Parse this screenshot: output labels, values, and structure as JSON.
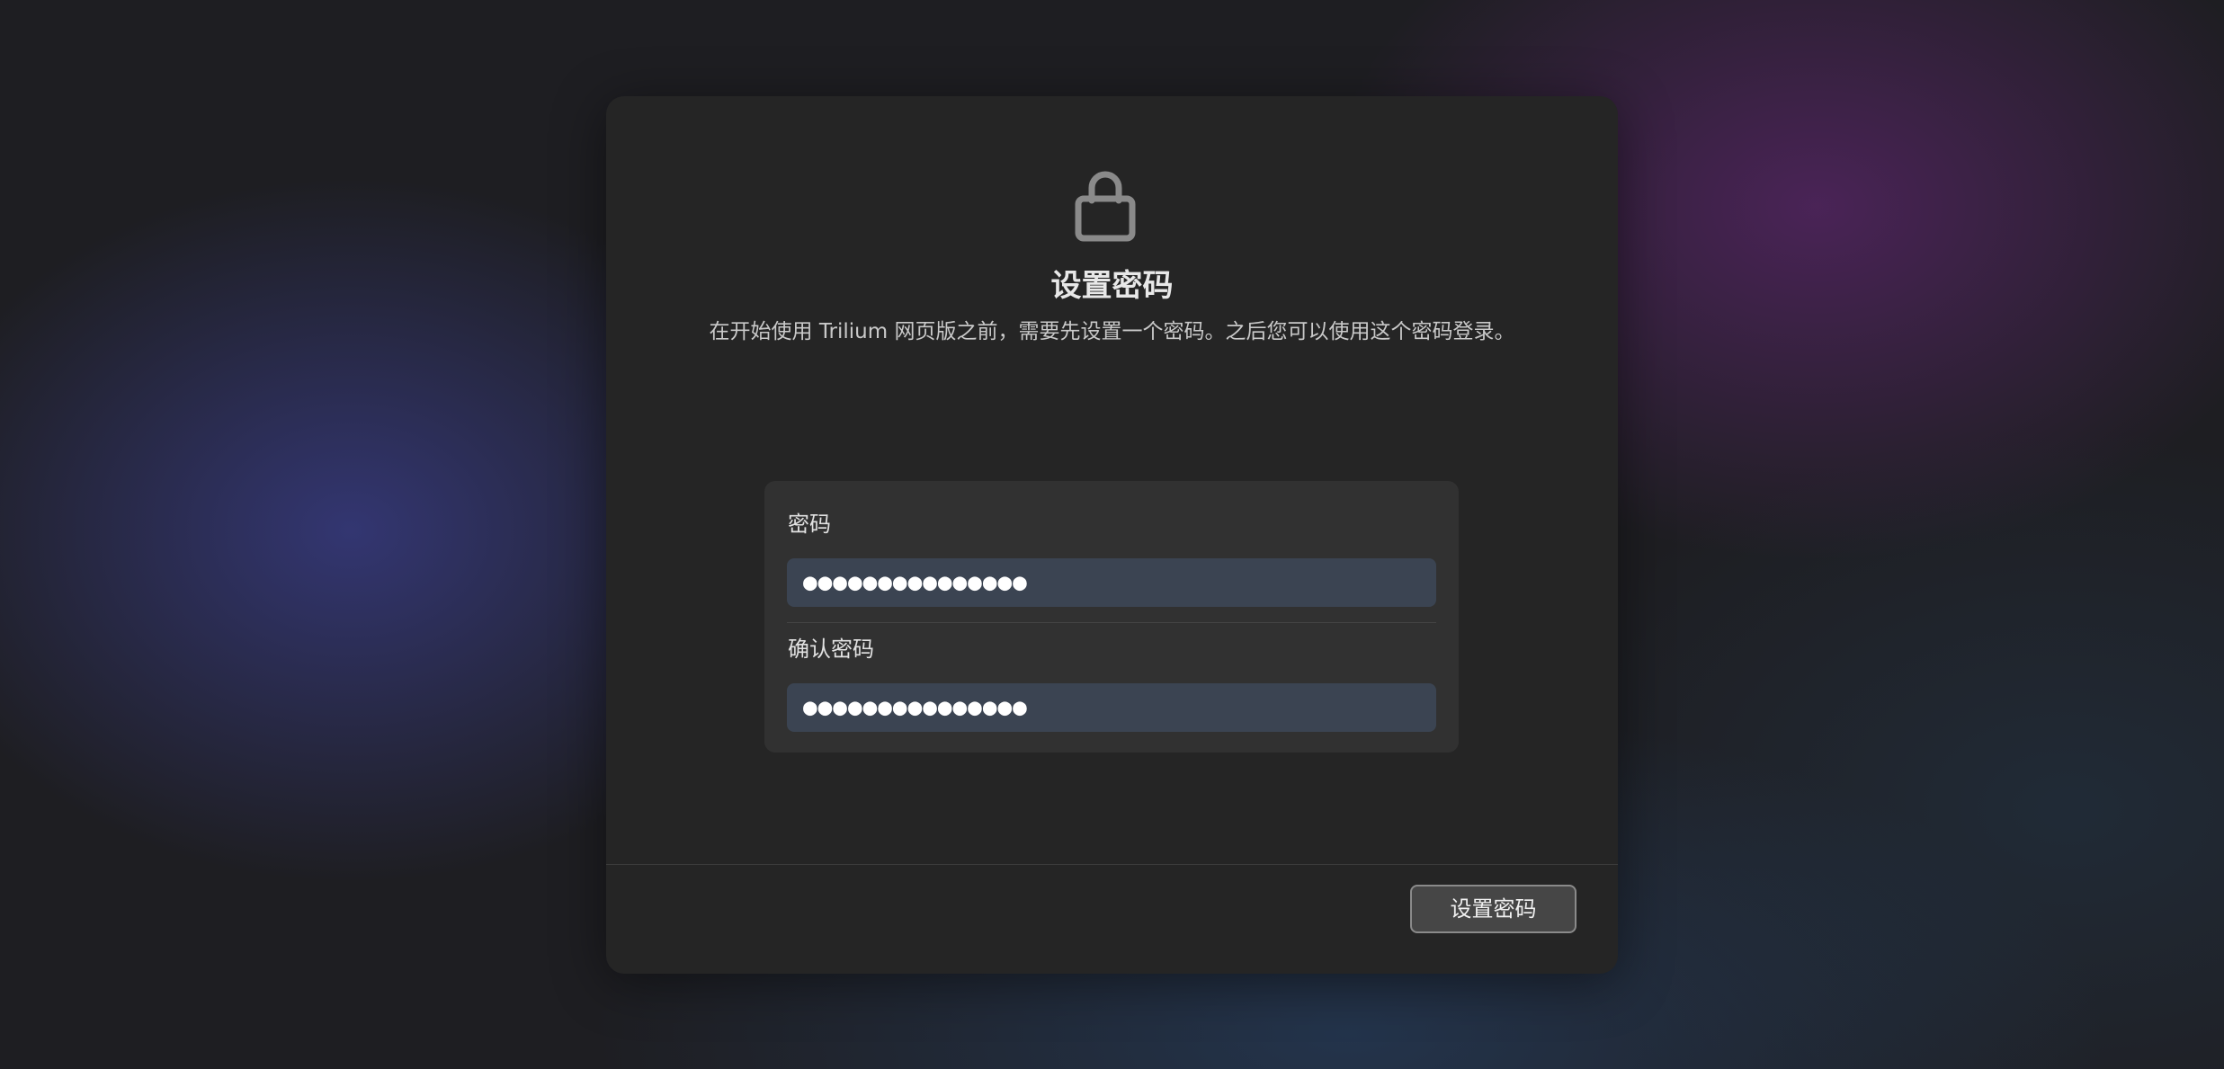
{
  "dialog": {
    "icon": "lock-icon",
    "title": "设置密码",
    "description": "在开始使用 Trilium 网页版之前，需要先设置一个密码。之后您可以使用这个密码登录。"
  },
  "form": {
    "password": {
      "label": "密码",
      "value": "●●●●●●●●●●●●●●●"
    },
    "confirm_password": {
      "label": "确认密码",
      "value": "●●●●●●●●●●●●●●●"
    }
  },
  "footer": {
    "submit_label": "设置密码"
  },
  "colors": {
    "dialog_bg": "#252525",
    "card_bg": "#313131",
    "input_bg": "#3b4452",
    "button_border": "#8a8a8a"
  }
}
